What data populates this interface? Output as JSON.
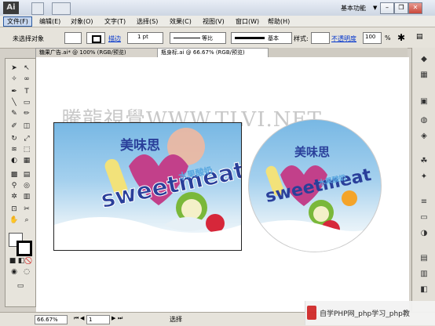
{
  "app": {
    "logo": "Ai",
    "workspace": "基本功能",
    "window_controls": [
      "–",
      "❐",
      "✕"
    ]
  },
  "menu": [
    "文件(F)",
    "编辑(E)",
    "对象(O)",
    "文字(T)",
    "选择(S)",
    "效果(C)",
    "视图(V)",
    "窗口(W)",
    "帮助(H)"
  ],
  "control": {
    "selection": "未选择对象",
    "stroke_link": "描边",
    "stroke_value": "1 pt",
    "profile_label": "等比",
    "brush_label": "基本",
    "style_label": "样式:",
    "opacity_link": "不透明度",
    "opacity_value": "100",
    "opacity_unit": "%"
  },
  "tabs": [
    {
      "label": "糖果广告.ai* @ 100% (RGB/预览)",
      "active": false
    },
    {
      "label": "瓶身标.ai @ 66.67% (RGB/预览)",
      "active": true
    }
  ],
  "artwork": {
    "watermark": "騰龍視覺WWW.TLVI.NET",
    "brand_cn": "美味思",
    "brand_en": "sweetmeat",
    "sub": "水果酸奶"
  },
  "status": {
    "zoom": "66.67%",
    "page": "1",
    "tool": "选择",
    "site_brand": "自学PHP网_php学习_php教"
  }
}
